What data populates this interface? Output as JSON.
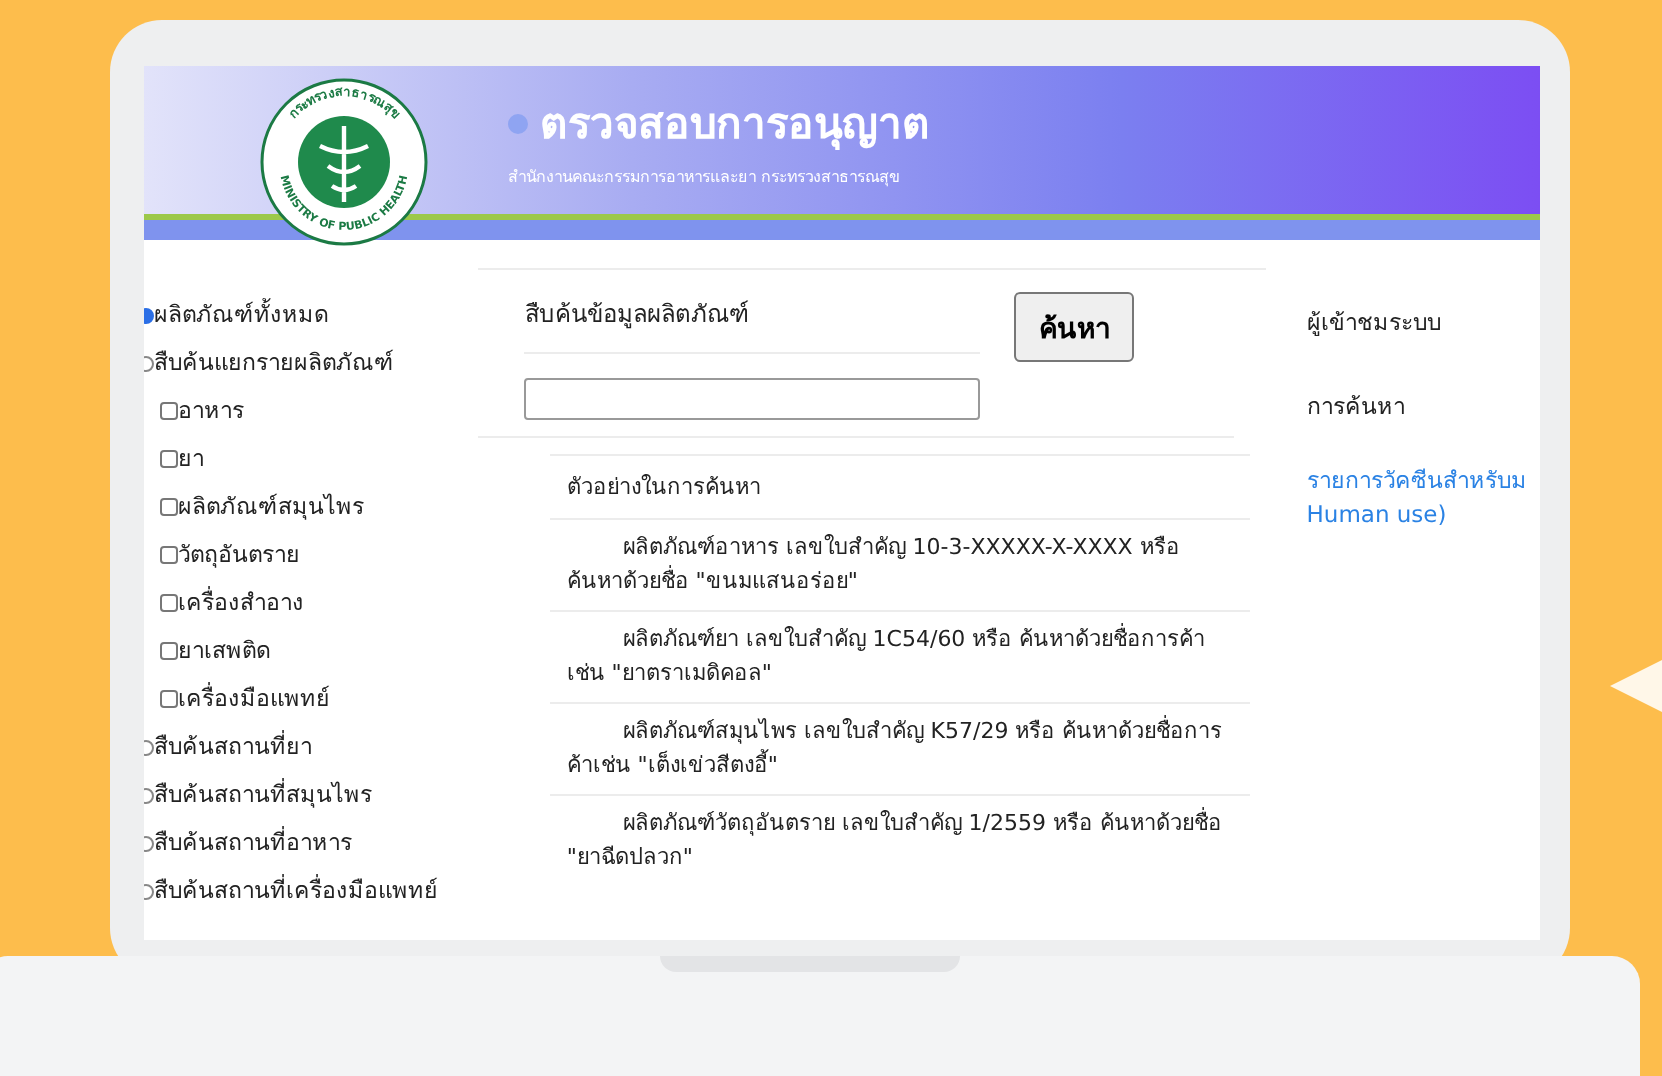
{
  "header": {
    "logo": {
      "top_text": "กระทรวงสาธารณสุข",
      "bottom_text": "MINISTRY OF PUBLIC HEALTH"
    },
    "title": "ตรวจสอบการอนุญาต",
    "subtitle": "สำนักงานคณะกรรมการอาหารและยา กระทรวงสาธารณสุข"
  },
  "sidebar": {
    "items": [
      {
        "label": "ผลิตภัณฑ์ทั้งหมด",
        "selected": true
      },
      {
        "label": "สืบค้นแยกรายผลิตภัณฑ์",
        "selected": false,
        "children": [
          {
            "label": "อาหาร",
            "checked": false
          },
          {
            "label": "ยา",
            "checked": false
          },
          {
            "label": "ผลิตภัณฑ์สมุนไพร",
            "checked": false
          },
          {
            "label": "วัตถุอันตราย",
            "checked": false
          },
          {
            "label": "เครื่องสำอาง",
            "checked": false
          },
          {
            "label": "ยาเสพติด",
            "checked": false
          },
          {
            "label": "เครื่องมือแพทย์",
            "checked": false
          }
        ]
      },
      {
        "label": "สืบค้นสถานที่ยา",
        "selected": false
      },
      {
        "label": "สืบค้นสถานที่สมุนไพร",
        "selected": false
      },
      {
        "label": "สืบค้นสถานที่อาหาร",
        "selected": false
      },
      {
        "label": "สืบค้นสถานที่เครื่องมือแพทย์",
        "selected": false
      }
    ]
  },
  "search": {
    "heading": "สืบค้นข้อมูลผลิตภัณฑ์",
    "button": "ค้นหา"
  },
  "examples": {
    "heading": "ตัวอย่างในการค้นหา",
    "items": [
      "ผลิตภัณฑ์อาหาร เลขใบสำคัญ 10-3-XXXXX-X-XXXX หรือ ค้นหาด้วยชื่อ  \"ขนมแสนอร่อย\"",
      "ผลิตภัณฑ์ยา เลขใบสำคัญ 1C54/60 หรือ ค้นหาด้วยชื่อการค้าเช่น \"ยาตราเมดิคอล\"",
      "ผลิตภัณฑ์สมุนไพร เลขใบสำคัญ K57/29 หรือ ค้นหาด้วยชื่อการค้าเช่น \"เต็งเข่วสีตงอี้\"",
      "ผลิตภัณฑ์วัตถุอันตราย เลขใบสำคัญ 1/2559 หรือ ค้นหาด้วยชื่อ \"ยาฉีดปลวก\""
    ]
  },
  "right_panel": {
    "visitors": "ผู้เข้าชมระบบ",
    "searches": "การค้นหา",
    "link_lines": [
      "รายการวัคซีนสำหรับม",
      "Human use)"
    ]
  }
}
